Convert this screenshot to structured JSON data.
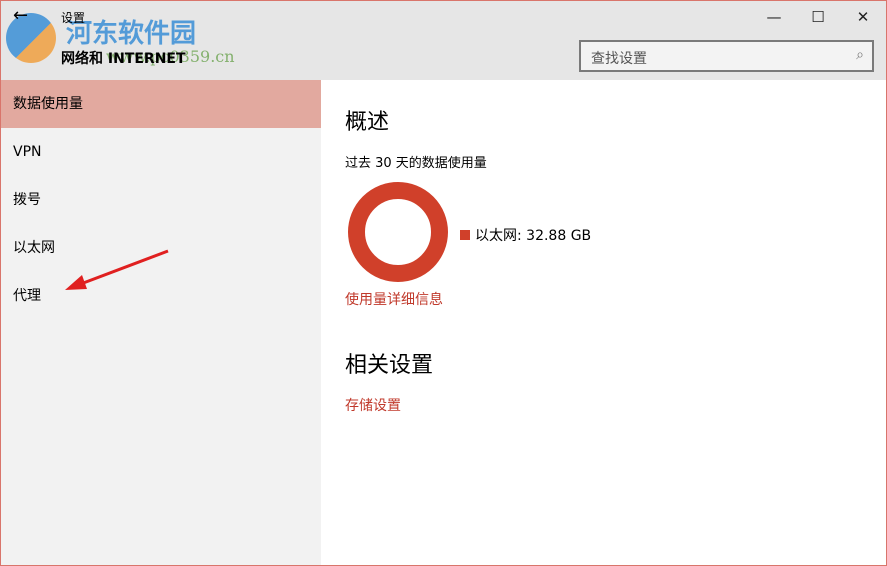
{
  "window": {
    "app_title": "设置",
    "section_title": "网络和 INTERNET",
    "minimize": "—",
    "maximize": "☐",
    "close": "✕",
    "back": "←"
  },
  "watermark": {
    "brand": "河东软件园",
    "url": "www.pc0359.cn"
  },
  "search": {
    "placeholder": "查找设置",
    "icon": "search-icon"
  },
  "sidebar": {
    "items": [
      {
        "label": "数据使用量",
        "active": true
      },
      {
        "label": "VPN"
      },
      {
        "label": "拨号"
      },
      {
        "label": "以太网"
      },
      {
        "label": "代理"
      }
    ]
  },
  "main": {
    "overview_title": "概述",
    "usage_caption": "过去 30 天的数据使用量",
    "chart": {
      "type": "pie",
      "series": [
        {
          "name": "以太网",
          "value": 32.88,
          "unit": "GB"
        }
      ],
      "legend_text": "以太网: 32.88 GB",
      "color": "#d0402a"
    },
    "usage_details_link": "使用量详细信息",
    "related_title": "相关设置",
    "storage_link": "存储设置"
  },
  "colors": {
    "accent": "#c0392b",
    "active_item": "#e2a99f"
  }
}
